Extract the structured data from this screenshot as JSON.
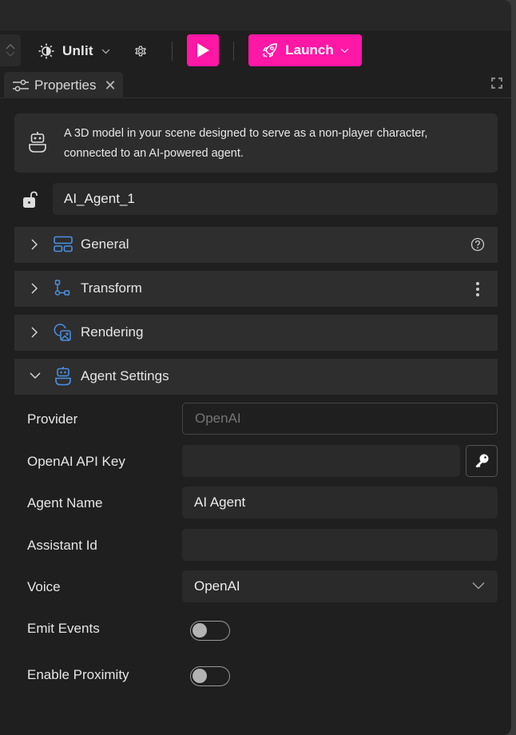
{
  "toolbar": {
    "lighting_mode": "Unlit",
    "launch_label": "Launch",
    "accent_color": "#ff17a6"
  },
  "tabs": [
    {
      "label": "Properties",
      "active": true,
      "closable": true
    }
  ],
  "info": {
    "description": "A 3D model in your scene designed to serve as a non-player character, connected to an AI-powered agent."
  },
  "object": {
    "name": "AI_Agent_1",
    "locked": false
  },
  "sections": [
    {
      "label": "General",
      "expanded": false,
      "icon": "layout-icon",
      "action": "help-icon"
    },
    {
      "label": "Transform",
      "expanded": false,
      "icon": "transform-nodes-icon",
      "action": "more-vertical-icon"
    },
    {
      "label": "Rendering",
      "expanded": false,
      "icon": "rendering-image-icon",
      "action": null
    },
    {
      "label": "Agent Settings",
      "expanded": true,
      "icon": "robot-icon",
      "action": null
    }
  ],
  "agent_settings": {
    "provider": {
      "label": "Provider",
      "placeholder": "OpenAI",
      "value": ""
    },
    "api_key": {
      "label": "OpenAI API Key",
      "value": ""
    },
    "agent_name": {
      "label": "Agent Name",
      "value": "AI Agent"
    },
    "assistant_id": {
      "label": "Assistant Id",
      "value": ""
    },
    "voice": {
      "label": "Voice",
      "selected": "OpenAI"
    },
    "emit_events": {
      "label": "Emit Events",
      "enabled": false
    },
    "enable_proximity": {
      "label": "Enable Proximity",
      "enabled": false
    }
  }
}
